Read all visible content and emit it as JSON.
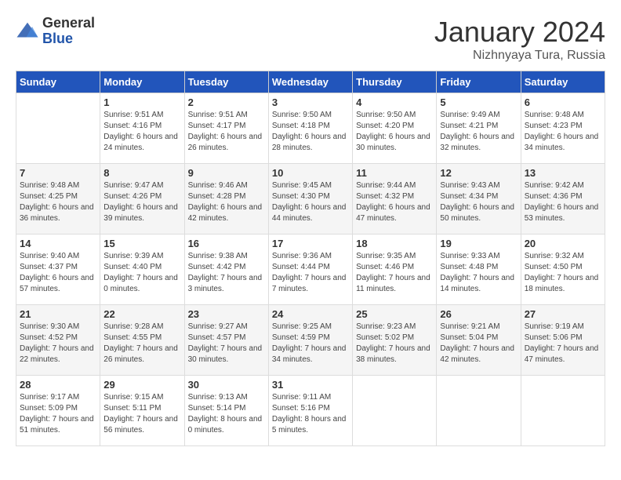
{
  "header": {
    "logo_general": "General",
    "logo_blue": "Blue",
    "month_title": "January 2024",
    "location": "Nizhnyaya Tura, Russia"
  },
  "weekdays": [
    "Sunday",
    "Monday",
    "Tuesday",
    "Wednesday",
    "Thursday",
    "Friday",
    "Saturday"
  ],
  "weeks": [
    [
      {
        "day": "",
        "sunrise": "",
        "sunset": "",
        "daylight": ""
      },
      {
        "day": "1",
        "sunrise": "Sunrise: 9:51 AM",
        "sunset": "Sunset: 4:16 PM",
        "daylight": "Daylight: 6 hours and 24 minutes."
      },
      {
        "day": "2",
        "sunrise": "Sunrise: 9:51 AM",
        "sunset": "Sunset: 4:17 PM",
        "daylight": "Daylight: 6 hours and 26 minutes."
      },
      {
        "day": "3",
        "sunrise": "Sunrise: 9:50 AM",
        "sunset": "Sunset: 4:18 PM",
        "daylight": "Daylight: 6 hours and 28 minutes."
      },
      {
        "day": "4",
        "sunrise": "Sunrise: 9:50 AM",
        "sunset": "Sunset: 4:20 PM",
        "daylight": "Daylight: 6 hours and 30 minutes."
      },
      {
        "day": "5",
        "sunrise": "Sunrise: 9:49 AM",
        "sunset": "Sunset: 4:21 PM",
        "daylight": "Daylight: 6 hours and 32 minutes."
      },
      {
        "day": "6",
        "sunrise": "Sunrise: 9:48 AM",
        "sunset": "Sunset: 4:23 PM",
        "daylight": "Daylight: 6 hours and 34 minutes."
      }
    ],
    [
      {
        "day": "7",
        "sunrise": "Sunrise: 9:48 AM",
        "sunset": "Sunset: 4:25 PM",
        "daylight": "Daylight: 6 hours and 36 minutes."
      },
      {
        "day": "8",
        "sunrise": "Sunrise: 9:47 AM",
        "sunset": "Sunset: 4:26 PM",
        "daylight": "Daylight: 6 hours and 39 minutes."
      },
      {
        "day": "9",
        "sunrise": "Sunrise: 9:46 AM",
        "sunset": "Sunset: 4:28 PM",
        "daylight": "Daylight: 6 hours and 42 minutes."
      },
      {
        "day": "10",
        "sunrise": "Sunrise: 9:45 AM",
        "sunset": "Sunset: 4:30 PM",
        "daylight": "Daylight: 6 hours and 44 minutes."
      },
      {
        "day": "11",
        "sunrise": "Sunrise: 9:44 AM",
        "sunset": "Sunset: 4:32 PM",
        "daylight": "Daylight: 6 hours and 47 minutes."
      },
      {
        "day": "12",
        "sunrise": "Sunrise: 9:43 AM",
        "sunset": "Sunset: 4:34 PM",
        "daylight": "Daylight: 6 hours and 50 minutes."
      },
      {
        "day": "13",
        "sunrise": "Sunrise: 9:42 AM",
        "sunset": "Sunset: 4:36 PM",
        "daylight": "Daylight: 6 hours and 53 minutes."
      }
    ],
    [
      {
        "day": "14",
        "sunrise": "Sunrise: 9:40 AM",
        "sunset": "Sunset: 4:37 PM",
        "daylight": "Daylight: 6 hours and 57 minutes."
      },
      {
        "day": "15",
        "sunrise": "Sunrise: 9:39 AM",
        "sunset": "Sunset: 4:40 PM",
        "daylight": "Daylight: 7 hours and 0 minutes."
      },
      {
        "day": "16",
        "sunrise": "Sunrise: 9:38 AM",
        "sunset": "Sunset: 4:42 PM",
        "daylight": "Daylight: 7 hours and 3 minutes."
      },
      {
        "day": "17",
        "sunrise": "Sunrise: 9:36 AM",
        "sunset": "Sunset: 4:44 PM",
        "daylight": "Daylight: 7 hours and 7 minutes."
      },
      {
        "day": "18",
        "sunrise": "Sunrise: 9:35 AM",
        "sunset": "Sunset: 4:46 PM",
        "daylight": "Daylight: 7 hours and 11 minutes."
      },
      {
        "day": "19",
        "sunrise": "Sunrise: 9:33 AM",
        "sunset": "Sunset: 4:48 PM",
        "daylight": "Daylight: 7 hours and 14 minutes."
      },
      {
        "day": "20",
        "sunrise": "Sunrise: 9:32 AM",
        "sunset": "Sunset: 4:50 PM",
        "daylight": "Daylight: 7 hours and 18 minutes."
      }
    ],
    [
      {
        "day": "21",
        "sunrise": "Sunrise: 9:30 AM",
        "sunset": "Sunset: 4:52 PM",
        "daylight": "Daylight: 7 hours and 22 minutes."
      },
      {
        "day": "22",
        "sunrise": "Sunrise: 9:28 AM",
        "sunset": "Sunset: 4:55 PM",
        "daylight": "Daylight: 7 hours and 26 minutes."
      },
      {
        "day": "23",
        "sunrise": "Sunrise: 9:27 AM",
        "sunset": "Sunset: 4:57 PM",
        "daylight": "Daylight: 7 hours and 30 minutes."
      },
      {
        "day": "24",
        "sunrise": "Sunrise: 9:25 AM",
        "sunset": "Sunset: 4:59 PM",
        "daylight": "Daylight: 7 hours and 34 minutes."
      },
      {
        "day": "25",
        "sunrise": "Sunrise: 9:23 AM",
        "sunset": "Sunset: 5:02 PM",
        "daylight": "Daylight: 7 hours and 38 minutes."
      },
      {
        "day": "26",
        "sunrise": "Sunrise: 9:21 AM",
        "sunset": "Sunset: 5:04 PM",
        "daylight": "Daylight: 7 hours and 42 minutes."
      },
      {
        "day": "27",
        "sunrise": "Sunrise: 9:19 AM",
        "sunset": "Sunset: 5:06 PM",
        "daylight": "Daylight: 7 hours and 47 minutes."
      }
    ],
    [
      {
        "day": "28",
        "sunrise": "Sunrise: 9:17 AM",
        "sunset": "Sunset: 5:09 PM",
        "daylight": "Daylight: 7 hours and 51 minutes."
      },
      {
        "day": "29",
        "sunrise": "Sunrise: 9:15 AM",
        "sunset": "Sunset: 5:11 PM",
        "daylight": "Daylight: 7 hours and 56 minutes."
      },
      {
        "day": "30",
        "sunrise": "Sunrise: 9:13 AM",
        "sunset": "Sunset: 5:14 PM",
        "daylight": "Daylight: 8 hours and 0 minutes."
      },
      {
        "day": "31",
        "sunrise": "Sunrise: 9:11 AM",
        "sunset": "Sunset: 5:16 PM",
        "daylight": "Daylight: 8 hours and 5 minutes."
      },
      {
        "day": "",
        "sunrise": "",
        "sunset": "",
        "daylight": ""
      },
      {
        "day": "",
        "sunrise": "",
        "sunset": "",
        "daylight": ""
      },
      {
        "day": "",
        "sunrise": "",
        "sunset": "",
        "daylight": ""
      }
    ]
  ]
}
